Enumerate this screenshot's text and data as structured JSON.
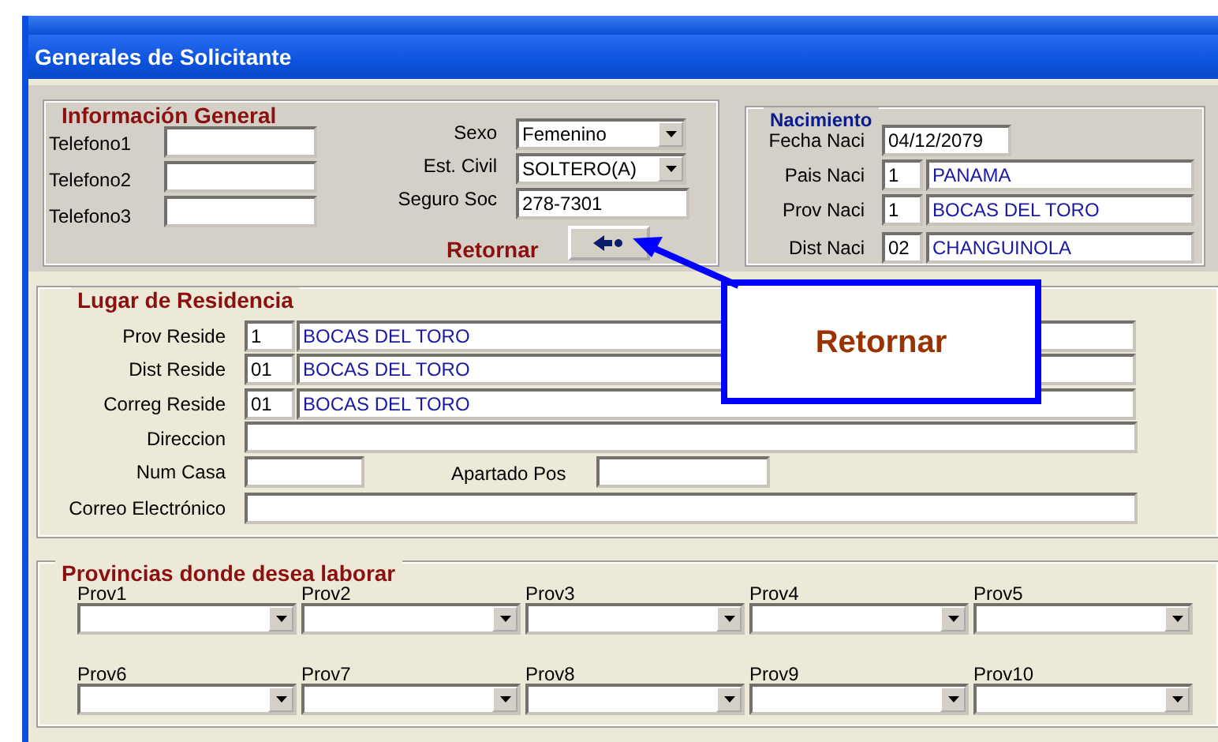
{
  "window": {
    "title": "Generales de Solicitante"
  },
  "informacion_general": {
    "title": "Información General",
    "phones": [
      {
        "label": "Telefono1"
      },
      {
        "label": "Telefono2"
      },
      {
        "label": "Telefono3"
      }
    ],
    "fields": [
      {
        "kind": "dropdown",
        "label": "Sexo",
        "value": "Femenino"
      },
      {
        "kind": "dropdown",
        "label": "Est. Civil",
        "value": "SOLTERO(A)"
      },
      {
        "kind": "text",
        "label": "Seguro Soc",
        "value": "278-7301"
      }
    ],
    "return_label": "Retornar"
  },
  "nacimiento": {
    "title": "Nacimiento",
    "fecha": {
      "label": "Fecha Naci",
      "value": "04/12/2079"
    },
    "rows": [
      {
        "label": "Pais Naci",
        "code": "1",
        "name": "PANAMA"
      },
      {
        "label": "Prov Naci",
        "code": "1",
        "name": "BOCAS DEL TORO"
      },
      {
        "label": "Dist Naci",
        "code": "02",
        "name": "CHANGUINOLA"
      }
    ]
  },
  "residencia": {
    "title": "Lugar de Residencia",
    "rows": [
      {
        "label": "Prov Reside",
        "code": "1",
        "name": "BOCAS DEL TORO"
      },
      {
        "label": "Dist Reside",
        "code": "01",
        "name": "BOCAS DEL TORO"
      },
      {
        "label": "Correg Reside",
        "code": "01",
        "name": "BOCAS DEL TORO"
      }
    ],
    "direccion": {
      "label": "Direccion"
    },
    "num_casa": {
      "label": "Num Casa"
    },
    "apartado": {
      "label": "Apartado Pos"
    },
    "correo": {
      "label": "Correo Electrónico"
    }
  },
  "provincias": {
    "title": "Provincias donde desea laborar",
    "fields": [
      {
        "label": "Prov1"
      },
      {
        "label": "Prov2"
      },
      {
        "label": "Prov3"
      },
      {
        "label": "Prov4"
      },
      {
        "label": "Prov5"
      },
      {
        "label": "Prov6"
      },
      {
        "label": "Prov7"
      },
      {
        "label": "Prov8"
      },
      {
        "label": "Prov9"
      },
      {
        "label": "Prov10"
      }
    ]
  },
  "callout": {
    "text": "Retornar"
  }
}
